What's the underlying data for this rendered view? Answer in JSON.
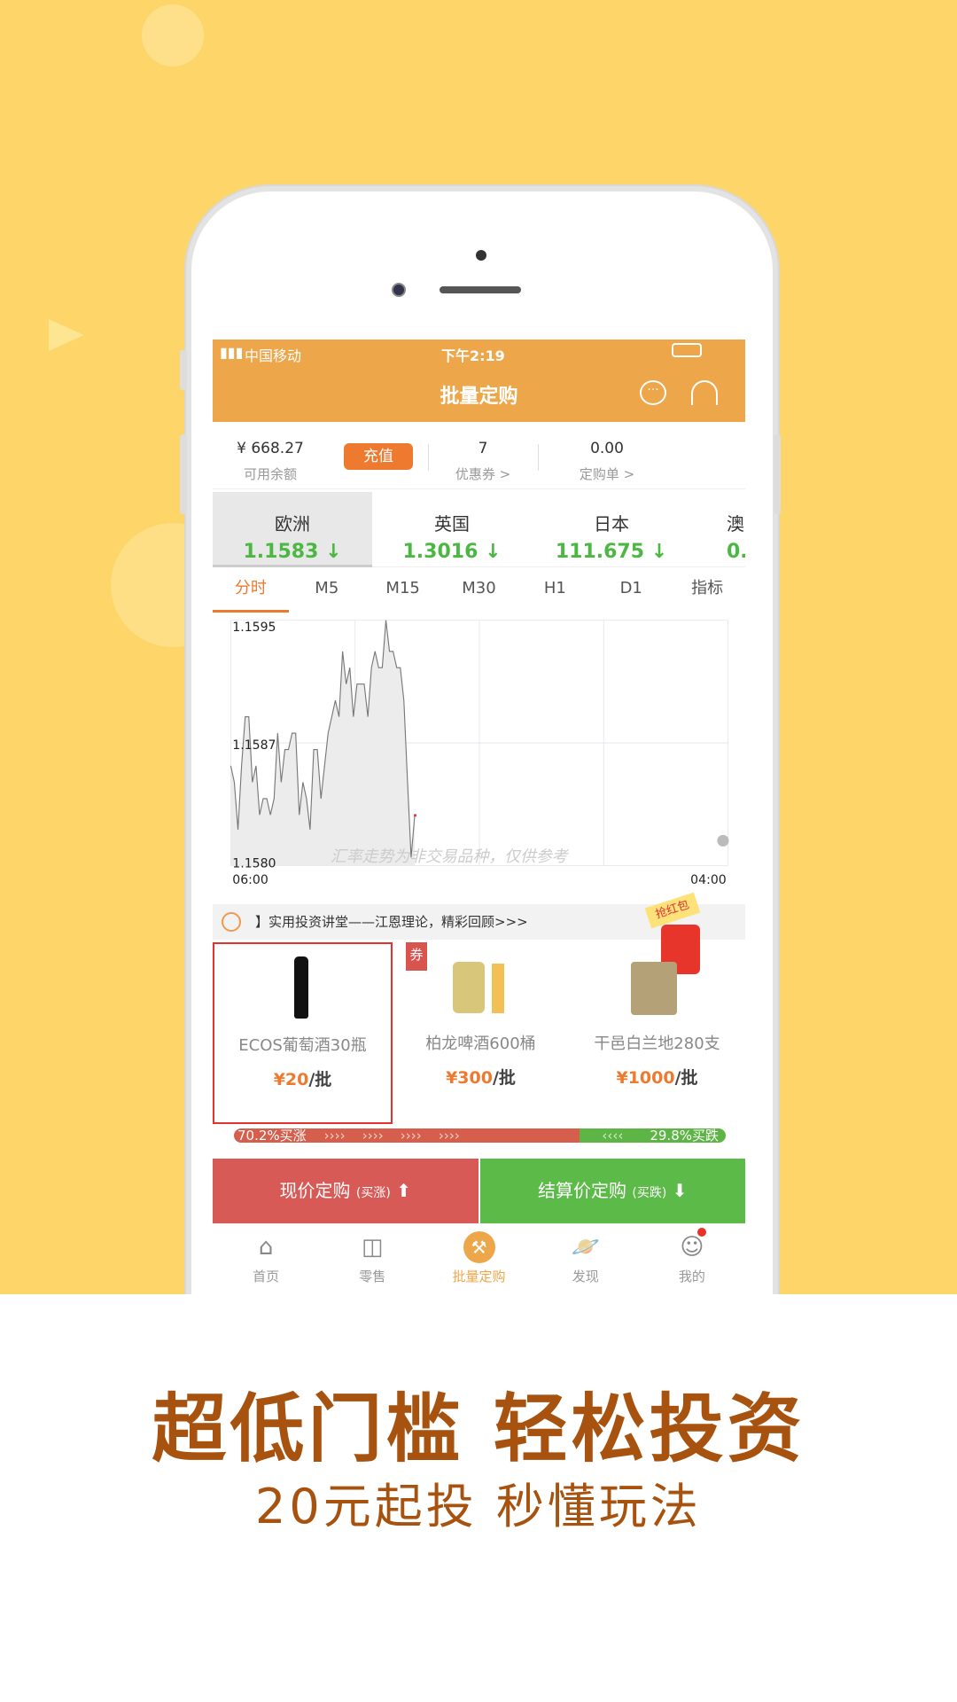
{
  "status_bar": {
    "carrier": "中国移动",
    "time": "下午2:19"
  },
  "header": {
    "title": "批量定购",
    "chat_icon": "chat-bubble-icon",
    "service_icon": "headset-icon"
  },
  "account": {
    "balance": "¥ 668.27",
    "balance_label": "可用余额",
    "recharge": "充值",
    "coupons": "7",
    "coupons_label": "优惠券 >",
    "orders": "0.00",
    "orders_label": "定购单 >"
  },
  "currencies": [
    {
      "name": "欧洲",
      "price": "1.1583",
      "dir": "↓"
    },
    {
      "name": "英国",
      "price": "1.3016",
      "dir": "↓"
    },
    {
      "name": "日本",
      "price": "111.675",
      "dir": "↓"
    },
    {
      "name": "澳",
      "price": "0.",
      "dir": ""
    }
  ],
  "timeframes": [
    "分时",
    "M5",
    "M15",
    "M30",
    "H1",
    "D1",
    "指标"
  ],
  "chart_data": {
    "type": "area",
    "x_range": [
      "06:00",
      "04:00"
    ],
    "y_ticks": [
      "1.1595",
      "1.1587",
      "1.1580"
    ],
    "ylim": [
      1.158,
      1.1595
    ],
    "watermark": "汇率走势为非交易品种，仅供参考",
    "grid": true,
    "values": [
      1.15861,
      1.15851,
      1.15822,
      1.15861,
      1.15891,
      1.15891,
      1.15851,
      1.15861,
      1.15831,
      1.15841,
      1.15841,
      1.15831,
      1.15841,
      1.15881,
      1.15851,
      1.15871,
      1.15871,
      1.15881,
      1.15881,
      1.15831,
      1.15851,
      1.15841,
      1.15822,
      1.15871,
      1.15871,
      1.15841,
      1.15861,
      1.15881,
      1.15891,
      1.15901,
      1.15891,
      1.15931,
      1.15911,
      1.15921,
      1.15891,
      1.15911,
      1.15911,
      1.15911,
      1.15891,
      1.15921,
      1.15931,
      1.15921,
      1.15921,
      1.1595,
      1.15931,
      1.15931,
      1.15921,
      1.15921,
      1.15901,
      1.15851,
      1.15805,
      1.15831
    ]
  },
  "news": "】实用投资讲堂——江恩理论，精彩回顾>>>",
  "red_packet": "抢红包",
  "products": [
    {
      "name": "ECOS葡萄酒30瓶",
      "price": "¥20",
      "unit": "/批"
    },
    {
      "name": "柏龙啤酒600桶",
      "price": "¥300",
      "unit": "/批",
      "badge": "券"
    },
    {
      "name": "干邑白兰地280支",
      "price": "¥1000",
      "unit": "/批"
    }
  ],
  "sentiment": {
    "up": "70.2%买涨",
    "down": "29.8%买跌",
    "up_pct": 70.2,
    "up_color": "#D55E4C",
    "down_color": "#5CB545"
  },
  "actions": {
    "buy_up": "现价定购",
    "buy_up_sub": "(买涨)",
    "buy_down": "结算价定购",
    "buy_down_sub": "(买跌)"
  },
  "nav": [
    {
      "label": "首页",
      "icon": "home-icon"
    },
    {
      "label": "零售",
      "icon": "bag-icon"
    },
    {
      "label": "批量定购",
      "icon": "hammer-icon"
    },
    {
      "label": "发现",
      "icon": "planet-icon"
    },
    {
      "label": "我的",
      "icon": "profile-icon"
    }
  ],
  "promo": {
    "headline": "超低门槛 轻松投资",
    "subline": "20元起投  秒懂玩法"
  }
}
